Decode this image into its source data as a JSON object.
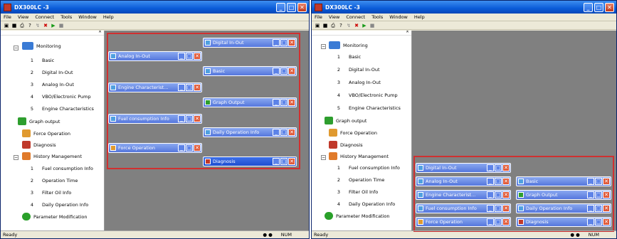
{
  "windows": [
    {
      "title": "DX300LC -3",
      "menu": [
        "File",
        "View",
        "Connect",
        "Tools",
        "Window",
        "Help"
      ],
      "tree": {
        "monitoring": "Monitoring",
        "monitoring_items": [
          {
            "num": "1",
            "label": "Basic"
          },
          {
            "num": "2",
            "label": "Digital In-Out"
          },
          {
            "num": "3",
            "label": "Analog In-Out"
          },
          {
            "num": "4",
            "label": "VBO/Electronic Pump"
          },
          {
            "num": "5",
            "label": "Engine Characteristics"
          }
        ],
        "graph_output": "Graph output",
        "force_operation": "Force Operation",
        "diagnosis": "Diagnosis",
        "history_management": "History Management",
        "history_items": [
          {
            "num": "1",
            "label": "Fuel consumption Info"
          },
          {
            "num": "2",
            "label": "Operation Time"
          },
          {
            "num": "3",
            "label": "Filter Oil Info"
          },
          {
            "num": "4",
            "label": "Daily Operation Info"
          }
        ],
        "parameter_modification": "Parameter Modification"
      },
      "mdi_windows": [
        "Digital In-Out",
        "Analog In-Out",
        "Basic",
        "Engine Characterist...",
        "Graph Output",
        "Fuel consumption Info",
        "Daily Operation Info",
        "Force Operation",
        "Diagnosis"
      ],
      "status": {
        "left": "Ready",
        "right": "NUM"
      }
    },
    {
      "title": "DX300LC -3",
      "menu": [
        "File",
        "View",
        "Connect",
        "Tools",
        "Window",
        "Help"
      ],
      "tree": {
        "monitoring": "Monitoring",
        "monitoring_items": [
          {
            "num": "1",
            "label": "Basic"
          },
          {
            "num": "2",
            "label": "Digital In-Out"
          },
          {
            "num": "3",
            "label": "Analog In-Out"
          },
          {
            "num": "4",
            "label": "VBO/Electronic Pump"
          },
          {
            "num": "5",
            "label": "Engine Characteristics"
          }
        ],
        "graph_output": "Graph output",
        "force_operation": "Force Operation",
        "diagnosis": "Diagnosis",
        "history_management": "History Management",
        "history_items": [
          {
            "num": "1",
            "label": "Fuel consumption Info"
          },
          {
            "num": "2",
            "label": "Operation Time"
          },
          {
            "num": "3",
            "label": "Filter Oil Info"
          },
          {
            "num": "4",
            "label": "Daily Operation Info"
          }
        ],
        "parameter_modification": "Parameter Modification"
      },
      "mdi_windows": [
        "Digital In-Out",
        "Analog In-Out",
        "Basic",
        "Engine Characterist...",
        "Graph Output",
        "Fuel consumption Info",
        "Daily Operation Info",
        "Force Operation",
        "Diagnosis"
      ],
      "status": {
        "left": "Ready",
        "right": "NUM"
      }
    }
  ],
  "colors": {
    "accent": "#0a5bd8",
    "highlight_box": "#d03030",
    "mdi_bg": "#808080"
  },
  "icons": {
    "close": "close-icon",
    "minimize": "minimize-icon",
    "maximize": "maximize-icon"
  }
}
